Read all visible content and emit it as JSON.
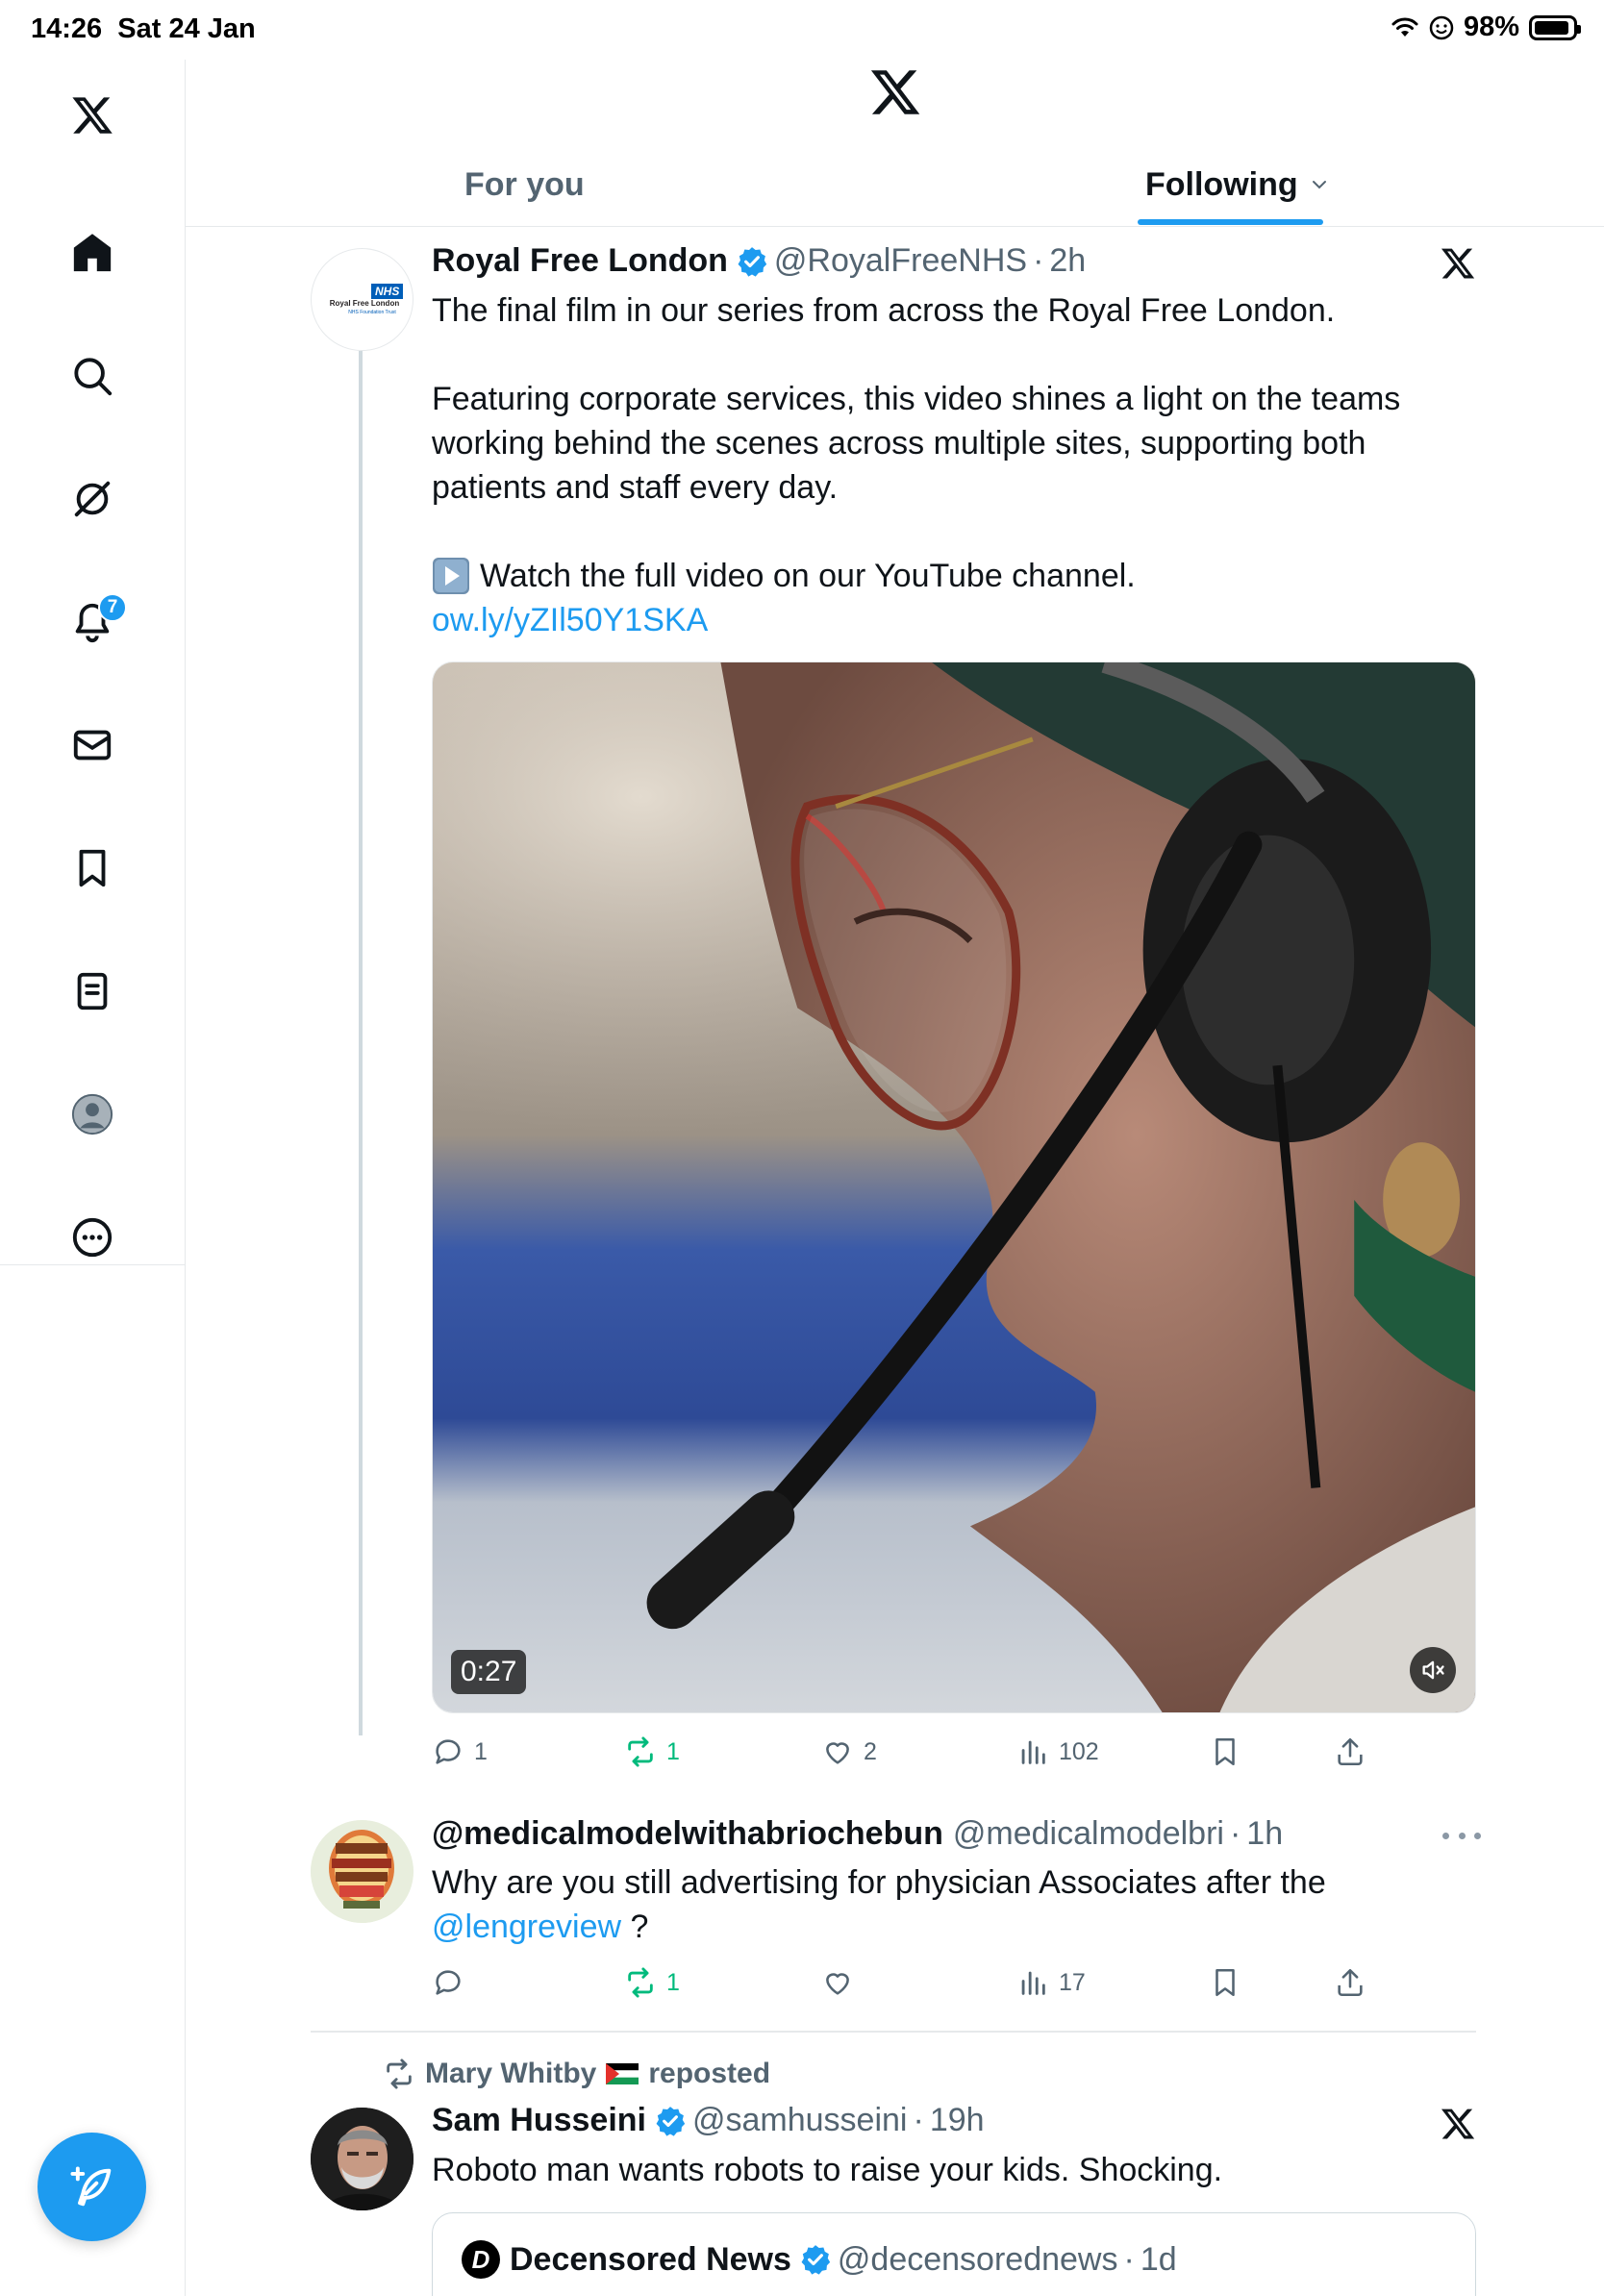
{
  "status_bar": {
    "time": "14:26",
    "date": "Sat 24 Jan",
    "battery": "98%"
  },
  "sidebar": {
    "items": [
      {
        "name": "home",
        "icon": "home-icon",
        "active": true
      },
      {
        "name": "explore",
        "icon": "search-icon"
      },
      {
        "name": "grok",
        "icon": "grok-icon"
      },
      {
        "name": "notifications",
        "icon": "bell-icon",
        "badge": "7"
      },
      {
        "name": "messages",
        "icon": "mail-icon"
      },
      {
        "name": "bookmarks",
        "icon": "bookmark-icon"
      },
      {
        "name": "lists",
        "icon": "list-icon"
      },
      {
        "name": "profile",
        "icon": "avatar-icon"
      },
      {
        "name": "more",
        "icon": "more-circle-icon"
      }
    ],
    "compose_icon": "feather-plus-icon"
  },
  "tabs": {
    "for_you": "For you",
    "following": "Following",
    "active": "following"
  },
  "tweets": [
    {
      "name": "Royal Free London",
      "avatar_text_1": "NHS",
      "avatar_text_2": "Royal Free London",
      "avatar_text_3": "NHS Foundation Trust",
      "verified": true,
      "handle": "@RoyalFreeNHS",
      "time": "2h",
      "text_1": "The final film in our series from across the Royal Free London.",
      "text_2": "Featuring corporate services, this video shines a light on the teams working behind the scenes across multiple sites, supporting both patients and staff every day.",
      "text_3": "Watch the full video on our YouTube channel.",
      "link": "ow.ly/yZIl50Y1SKA",
      "video_duration": "0:27",
      "replies": "1",
      "reposts": "1",
      "likes": "2",
      "views": "102"
    },
    {
      "name": "@medicalmodelwithabriochebun",
      "handle": "@medicalmodelbri",
      "time": "1h",
      "text": "Why are you still advertising for physician Associates after the",
      "mention": "@lengreview",
      "text_end": " ?",
      "replies": "",
      "reposts": "1",
      "likes": "",
      "views": "17"
    },
    {
      "reposted_by": "Mary Whitby",
      "reposted_label": "reposted",
      "name": "Sam Husseini",
      "verified": true,
      "handle": "@samhusseini",
      "time": "19h",
      "text": "Roboto man wants robots to raise your kids. Shocking.",
      "quote": {
        "avatar_letter": "D",
        "name": "Decensored News",
        "verified": true,
        "handle": "@decensorednews",
        "time": "1d"
      }
    }
  ],
  "colors": {
    "accent": "#1d9bf0",
    "repost_green": "#00ba7c",
    "text": "#0f1419",
    "secondary": "#536471"
  }
}
